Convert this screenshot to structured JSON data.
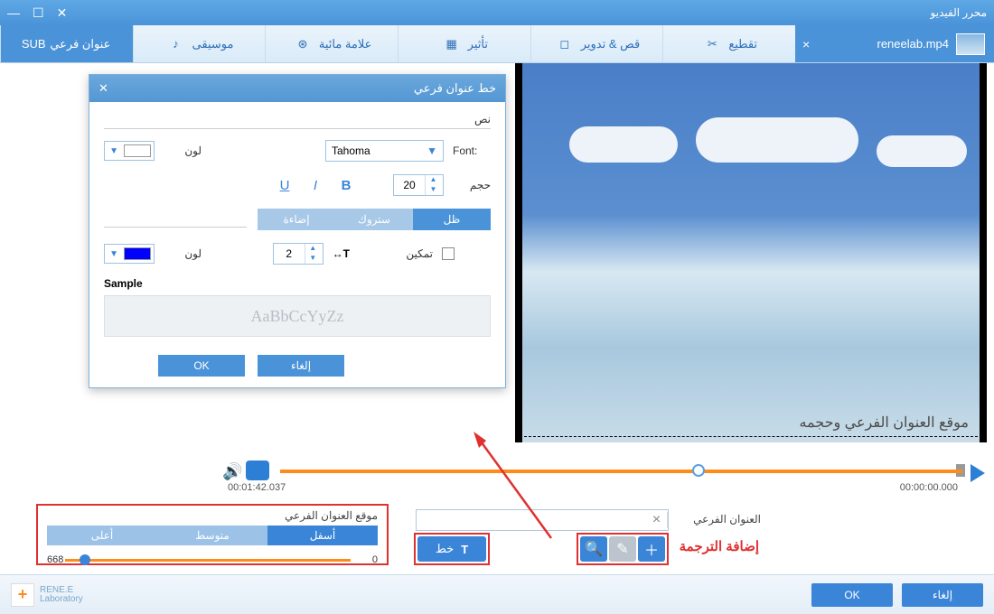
{
  "title": "محرر الفيديو",
  "file": {
    "name": "reneelab.mp4"
  },
  "tools": {
    "cut": "تقطيع",
    "crop": "قص & تدوير",
    "effect": "تأثير",
    "watermark": "علامة مائية",
    "music": "موسيقى",
    "subtitle": "عنوان فرعي"
  },
  "preview_caption": "موقع العنوان الفرعي وحجمه",
  "timeline": {
    "start": "00:00:00.000",
    "end": "00:01:42.037"
  },
  "subtitle_panel": {
    "label": "العنوان الفرعي",
    "add_hint": "إضافة الترجمة",
    "font_btn": "خط",
    "position_label": "موقع العنوان الفرعي",
    "pos_bottom": "أسفل",
    "pos_middle": "متوسط",
    "pos_top": "أعلى",
    "slider_min": "0",
    "slider_val": "668"
  },
  "dialog": {
    "title": "خط عنوان فرعي",
    "section_text": "نص",
    "font_label": "Font:",
    "font_value": "Tahoma",
    "color_label": "لون",
    "text_color": "#ffffff",
    "size_label": "حجم",
    "size_value": "20",
    "bold": "B",
    "italic": "I",
    "underline": "U",
    "tab_shadow": "ظل",
    "tab_stroke": "ستروك",
    "tab_glow": "إضاءة",
    "enable_label": "تمكين",
    "offset_value": "2",
    "shadow_color": "#0000ff",
    "sample_label": "Sample",
    "sample_text": "AaBbCcYyZz",
    "ok": "OK",
    "cancel": "إلغاء"
  },
  "footer": {
    "brand1": "RENE.E",
    "brand2": "Laboratory",
    "ok": "OK",
    "cancel": "إلغاء"
  }
}
